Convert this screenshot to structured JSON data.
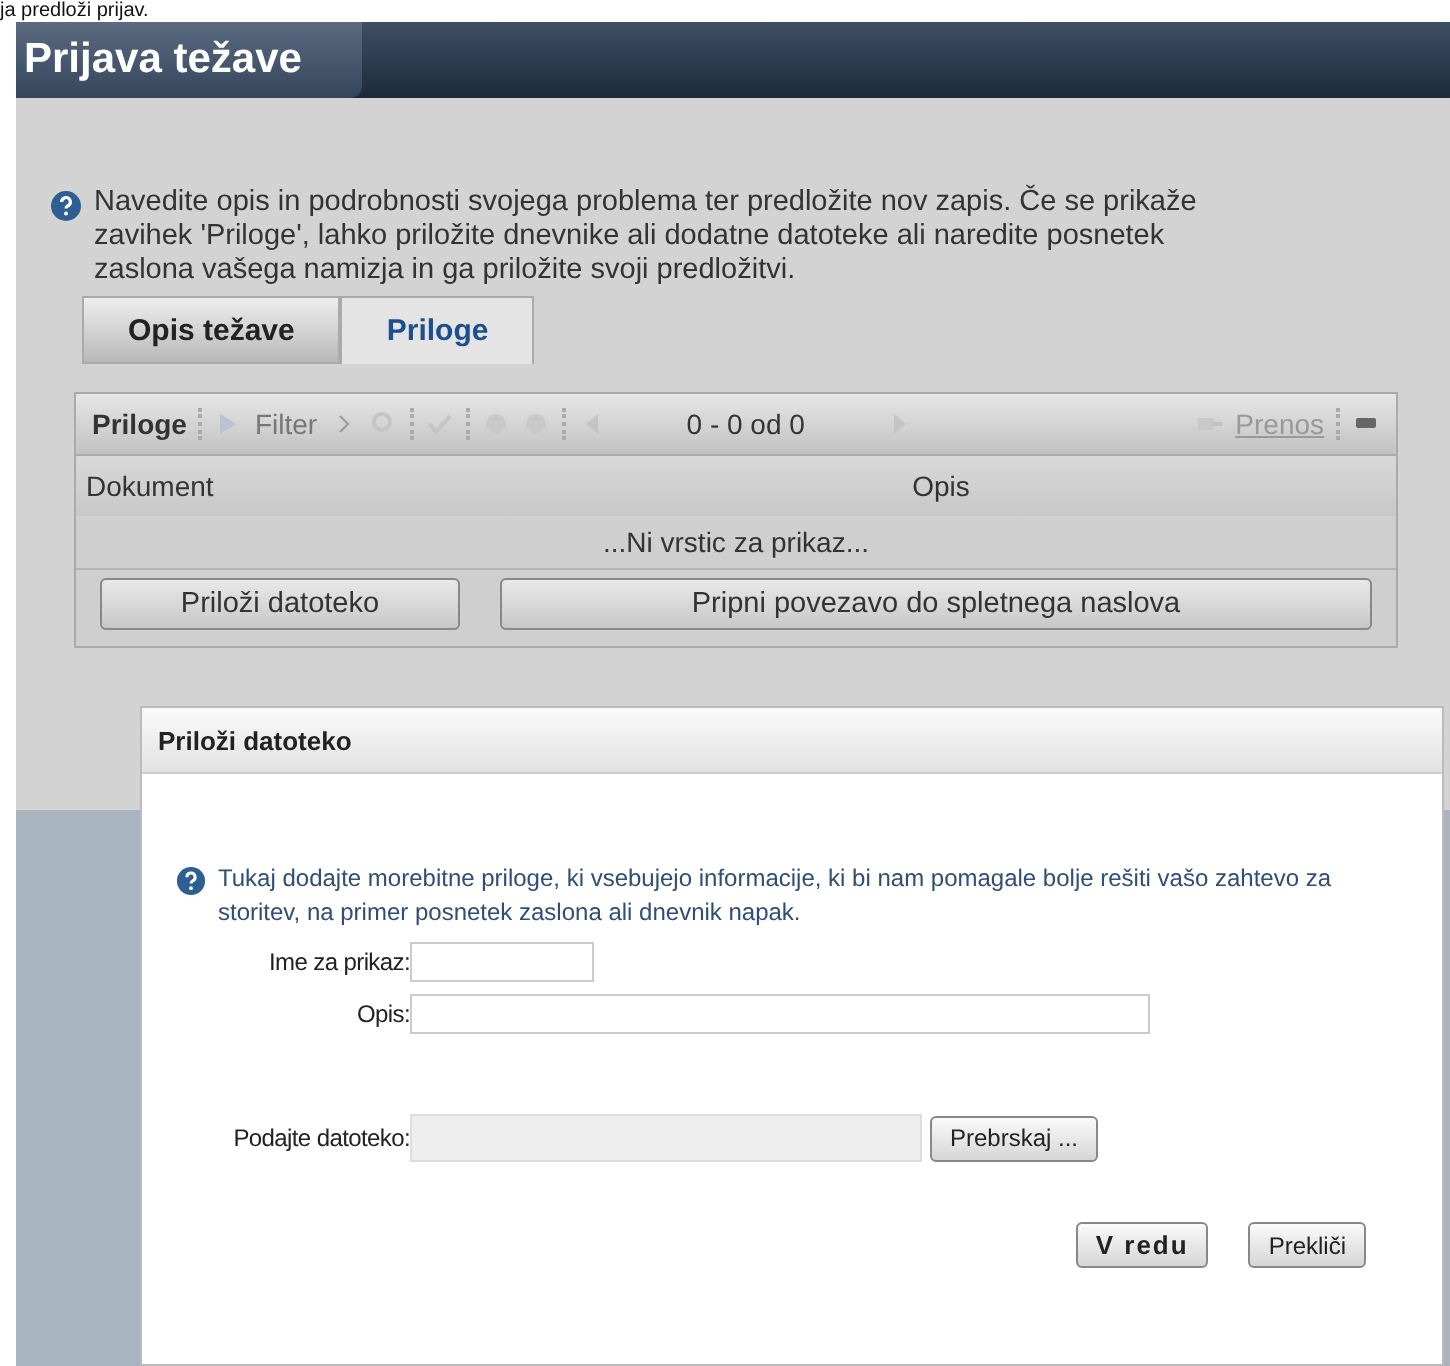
{
  "top_text": "ja predloži prijav.",
  "page": {
    "title": "Prijava težave",
    "info": "Navedite opis in podrobnosti svojega problema ter predložite nov zapis. Če se prikaže zavihek 'Priloge', lahko priložite dnevnike ali dodatne datoteke ali naredite posnetek zaslona vašega namizja in ga priložite svoji predložitvi."
  },
  "tabs": [
    {
      "label": "Opis težave",
      "selected": false
    },
    {
      "label": "Priloge",
      "selected": true
    }
  ],
  "grid": {
    "title": "Priloge",
    "filter": {
      "label": "Filter",
      "disabled": true
    },
    "paging": "0 - 0 od 0",
    "export": {
      "label": "Prenos",
      "disabled": true
    },
    "columns": [
      "Dokument",
      "Opis"
    ],
    "empty": "...Ni vrstic za prikaz...",
    "buttons": [
      "Priloži datoteko",
      "Pripni povezavo do spletnega naslova"
    ]
  },
  "dialog": {
    "title": "Priloži datoteko",
    "info": "Tukaj dodajte morebitne priloge, ki vsebujejo informacije, ki bi nam pomagale bolje rešiti vašo zahtevo za storitev, na primer posnetek zaslona ali dnevnik napak.",
    "fields": [
      {
        "kind": "short",
        "label": "Ime za prikaz:"
      },
      {
        "kind": "long",
        "label": "Opis:"
      }
    ],
    "file": {
      "label": "Podajte datoteko:",
      "button": "Prebrskaj ..."
    },
    "buttons": [
      {
        "label": "V redu",
        "primary": true
      },
      {
        "label": "Prekliči",
        "primary": false
      }
    ]
  }
}
